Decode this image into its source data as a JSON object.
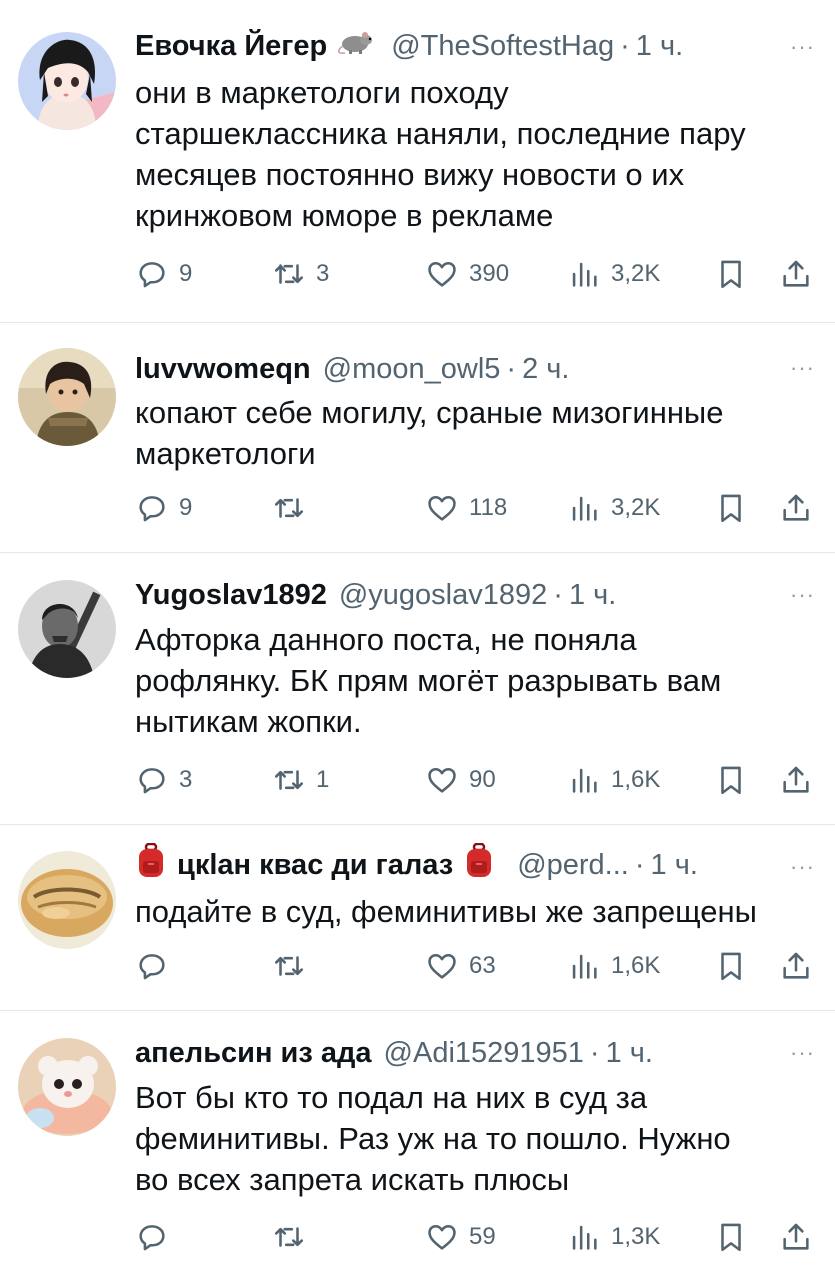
{
  "tweets": [
    {
      "name": "Евочка Йегер",
      "name_emoji": "rat-icon",
      "handle": "@TheSoftestHag",
      "dot": "·",
      "time": "1 ч.",
      "more": "···",
      "text": "они в маркетологи походу\nстаршеклассника наняли, последние пару\nмесяцев постоянно вижу новости о их\nкринжовом юморе в рекламе",
      "replies": "9",
      "retweets": "3",
      "likes": "390",
      "views": "3,2K"
    },
    {
      "name": "luvvwomeqn",
      "handle": "@moon_owl5",
      "dot": "·",
      "time": "2 ч.",
      "more": "···",
      "text": "копают себе могилу, сраные мизогинные\nмаркетологи",
      "replies": "9",
      "retweets": "",
      "likes": "118",
      "views": "3,2K"
    },
    {
      "name": "Yugoslav1892",
      "handle": "@yugoslav1892",
      "dot": "·",
      "time": "1 ч.",
      "more": "···",
      "text": "Афторка данного поста, не поняла\nрофлянку. БК прям могёт разрывать вам\nнытикам жопки.",
      "replies": "3",
      "retweets": "1",
      "likes": "90",
      "views": "1,6K"
    },
    {
      "name": "цкlан квас ди галаз",
      "name_emoji": "backpack-icon",
      "handle": "@perd...",
      "dot": "·",
      "time": "1 ч.",
      "more": "···",
      "text": "подайте в суд, феминитивы же запрещены",
      "replies": "",
      "retweets": "",
      "likes": "63",
      "views": "1,6K"
    },
    {
      "name": "апельсин из ада",
      "handle": "@Adi15291951",
      "dot": "·",
      "time": "1 ч.",
      "more": "···",
      "text": "Вот бы кто то подал на них в суд за\nфеминитивы. Раз уж на то пошло. Нужно\nво всех запрета искать плюсы",
      "replies": "",
      "retweets": "",
      "likes": "59",
      "views": "1,3K"
    }
  ],
  "colors": {
    "text": "#0f1419",
    "secondary": "#536471",
    "divider": "#e6e9eb"
  },
  "icons": [
    "reply-icon",
    "retweet-icon",
    "like-icon",
    "views-icon",
    "bookmark-icon",
    "share-icon"
  ]
}
